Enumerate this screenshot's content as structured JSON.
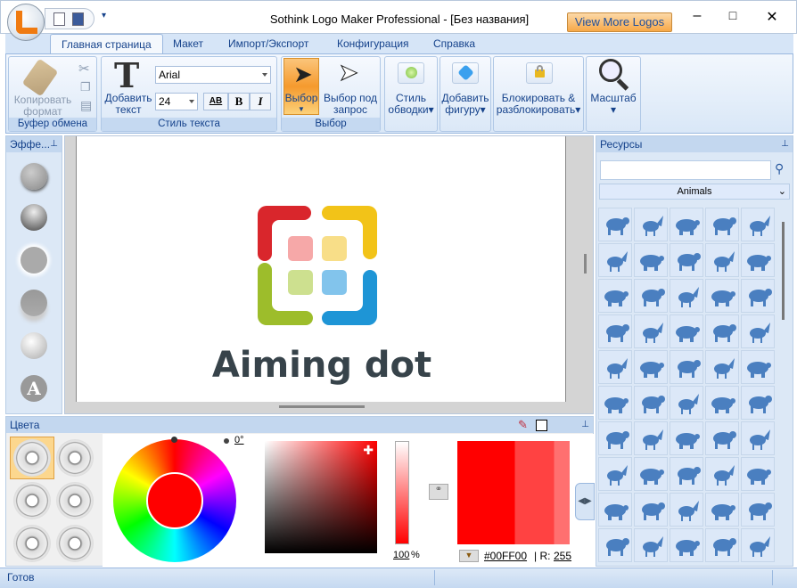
{
  "window": {
    "title": "Sothink Logo Maker Professional - [Без названия]",
    "view_more": "View More Logos"
  },
  "tabs": [
    "Главная страница",
    "Макет",
    "Импорт/Экспорт",
    "Конфигурация",
    "Справка"
  ],
  "ribbon": {
    "clipboard": {
      "copy_format": "Копировать",
      "copy_format2": "формат",
      "label": "Буфер обмена"
    },
    "text_style": {
      "add_text": "Добавить",
      "add_text2": "текст",
      "font": "Arial",
      "size": "24",
      "bold": "B",
      "italic": "I",
      "spacing": "AB",
      "label": "Стиль текста"
    },
    "select": {
      "select": "Выбор",
      "select_query": "Выбор под",
      "select_query2": "запрос",
      "label": "Выбор"
    },
    "stroke": {
      "l1": "Стиль",
      "l2": "обводки"
    },
    "shape": {
      "l1": "Добавить",
      "l2": "фигуру"
    },
    "lock": {
      "l1": "Блокировать &",
      "l2": "разблокировать"
    },
    "zoom": {
      "l1": "Масштаб"
    }
  },
  "effects": {
    "title": "Эффе..."
  },
  "logo": {
    "text": "Aiming dot",
    "colors": {
      "red": "#d9262c",
      "yellow": "#f2c318",
      "green": "#9dbd2b",
      "blue": "#1e95d6"
    }
  },
  "resources": {
    "title": "Ресурсы",
    "search_placeholder": "",
    "category": "Animals"
  },
  "colors": {
    "title": "Цвета",
    "hue_angle": "0°",
    "alpha": "100",
    "alpha_unit": "%",
    "hex": "#00FF00",
    "r_label": "R:",
    "r_value": "255",
    "current": "#ff0000"
  },
  "status": {
    "text": "Готов"
  }
}
